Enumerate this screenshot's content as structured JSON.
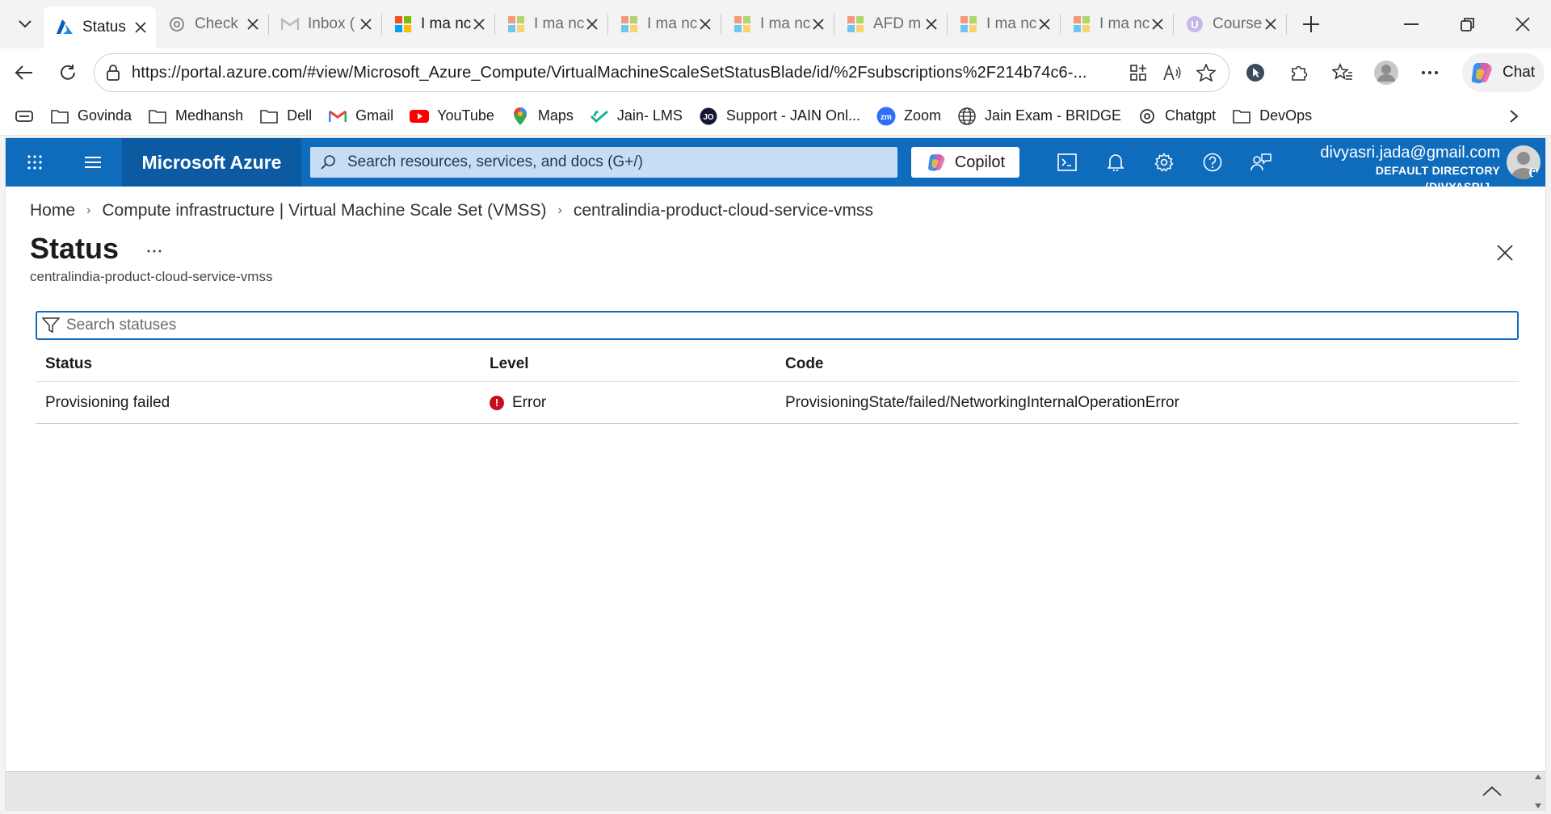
{
  "browser": {
    "tabs": [
      {
        "title": "Status",
        "favicon": "azure-icon",
        "active": true
      },
      {
        "title": "Check",
        "favicon": "chatgpt-icon",
        "active": false
      },
      {
        "title": "Inbox (",
        "favicon": "gmail-icon",
        "active": false
      },
      {
        "title": "I ma nc",
        "favicon": "microsoft-icon",
        "active": false
      },
      {
        "title": "I ma nc",
        "favicon": "microsoft-icon",
        "active": false
      },
      {
        "title": "I ma nc",
        "favicon": "microsoft-icon",
        "active": false
      },
      {
        "title": "I ma nc",
        "favicon": "microsoft-icon",
        "active": false
      },
      {
        "title": "AFD m",
        "favicon": "microsoft-icon",
        "active": false
      },
      {
        "title": "I ma nc",
        "favicon": "microsoft-icon",
        "active": false
      },
      {
        "title": "I ma nc",
        "favicon": "microsoft-icon",
        "active": false
      },
      {
        "title": "Course",
        "favicon": "course-icon",
        "active": false
      }
    ],
    "url": "https://portal.azure.com/#view/Microsoft_Azure_Compute/VirtualMachineScaleSetStatusBlade/id/%2Fsubscriptions%2F214b74c6-...",
    "chat_label": "Chat",
    "bookmarks": [
      {
        "label": "Govinda",
        "icon": "folder-icon"
      },
      {
        "label": "Medhansh",
        "icon": "folder-icon"
      },
      {
        "label": "Dell",
        "icon": "folder-icon"
      },
      {
        "label": "Gmail",
        "icon": "gmail-icon"
      },
      {
        "label": "YouTube",
        "icon": "youtube-icon"
      },
      {
        "label": "Maps",
        "icon": "maps-icon"
      },
      {
        "label": "Jain- LMS",
        "icon": "lms-icon"
      },
      {
        "label": "Support - JAIN Onl...",
        "icon": "jain-icon"
      },
      {
        "label": "Zoom",
        "icon": "zoom-icon"
      },
      {
        "label": "Jain Exam - BRIDGE",
        "icon": "globe-icon"
      },
      {
        "label": "Chatgpt",
        "icon": "chatgpt-icon"
      },
      {
        "label": "DevOps",
        "icon": "folder-icon"
      }
    ]
  },
  "azure": {
    "brand": "Microsoft Azure",
    "search_placeholder": "Search resources, services, and docs (G+/)",
    "copilot_label": "Copilot",
    "account_email": "divyasri.jada@gmail.com",
    "account_directory": "DEFAULT DIRECTORY (DIVYASRIJ...",
    "breadcrumb": [
      "Home",
      "Compute infrastructure | Virtual Machine Scale Set (VMSS)",
      "centralindia-product-cloud-service-vmss"
    ],
    "page_title": "Status",
    "page_subtitle": "centralindia-product-cloud-service-vmss",
    "filter_placeholder": "Search statuses",
    "table": {
      "headers": [
        "Status",
        "Level",
        "Code"
      ],
      "rows": [
        {
          "status": "Provisioning failed",
          "level": "Error",
          "code": "ProvisioningState/failed/NetworkingInternalOperationError"
        }
      ]
    }
  },
  "colors": {
    "azure_header": "#0f6cbd",
    "error": "#c50f1f"
  }
}
